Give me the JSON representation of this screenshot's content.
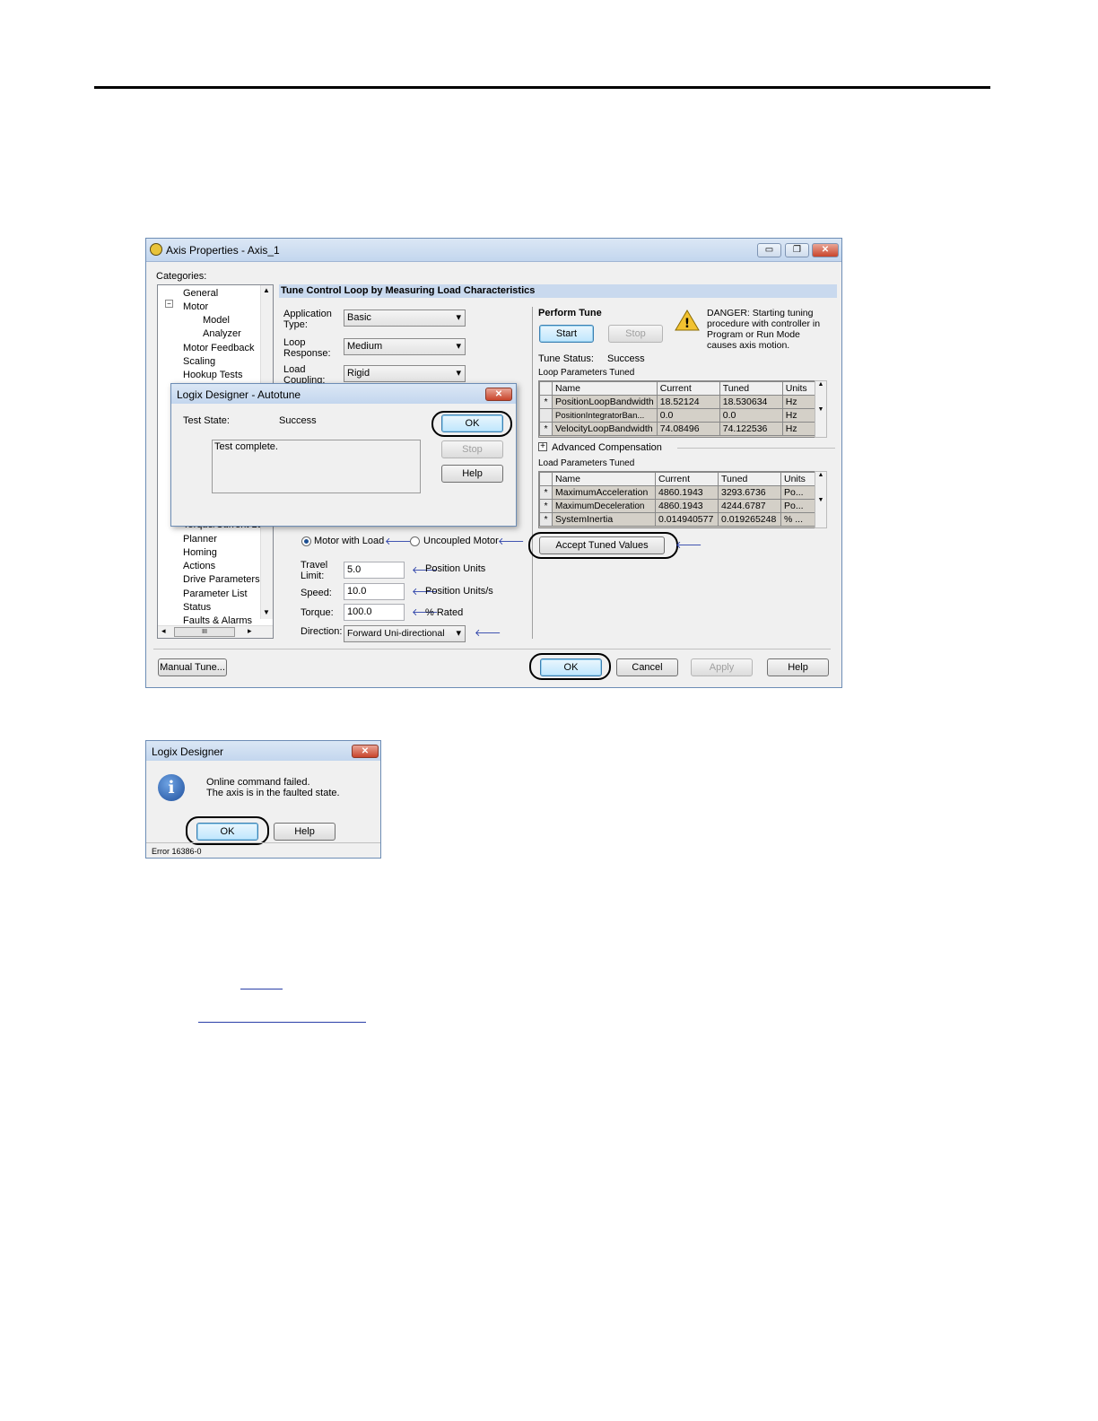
{
  "window": {
    "title": "Axis Properties - Axis_1",
    "categories_label": "Categories:",
    "tree": [
      "General",
      "Motor",
      "Model",
      "Analyzer",
      "Motor Feedback",
      "Scaling",
      "Hookup Tests",
      "Torque/Current Lo",
      "Planner",
      "Homing",
      "Actions",
      "Drive Parameters",
      "Parameter List",
      "Status",
      "Faults & Alarms"
    ],
    "hscroll_thumb": "III",
    "section_title": "Tune Control Loop by Measuring Load Characteristics",
    "application_type_label": "Application Type:",
    "application_type_value": "Basic",
    "loop_response_label": "Loop Response:",
    "loop_response_value": "Medium",
    "load_coupling_label": "Load Coupling:",
    "load_coupling_value": "Rigid",
    "motor_with_load": "Motor with Load",
    "uncoupled_motor": "Uncoupled Motor",
    "travel_limit_label": "Travel Limit:",
    "travel_limit_value": "5.0",
    "travel_limit_unit": "Position Units",
    "speed_label": "Speed:",
    "speed_value": "10.0",
    "speed_unit": "Position Units/s",
    "torque_label": "Torque:",
    "torque_value": "100.0",
    "torque_unit": "% Rated",
    "direction_label": "Direction:",
    "direction_value": "Forward Uni-directional",
    "perform_tune": "Perform Tune",
    "start": "Start",
    "stop": "Stop",
    "danger": "DANGER: Starting tuning procedure with controller in Program or Run Mode causes axis motion.",
    "tune_status_label": "Tune Status:",
    "tune_status_value": "Success",
    "loop_params_label": "Loop Parameters Tuned",
    "load_params_label": "Load Parameters Tuned",
    "advanced_comp": "Advanced Compensation",
    "grid_headers": [
      "Name",
      "Current",
      "Tuned",
      "Units"
    ],
    "loop_rows": [
      {
        "star": "*",
        "name": "PositionLoopBandwidth",
        "current": "18.52124",
        "tuned": "18.530634",
        "units": "Hz"
      },
      {
        "star": "",
        "name": "PositionIntegratorBan...",
        "current": "0.0",
        "tuned": "0.0",
        "units": "Hz"
      },
      {
        "star": "*",
        "name": "VelocityLoopBandwidth",
        "current": "74.08496",
        "tuned": "74.122536",
        "units": "Hz"
      }
    ],
    "load_rows": [
      {
        "star": "*",
        "name": "MaximumAcceleration",
        "current": "4860.1943",
        "tuned": "3293.6736",
        "units": "Po..."
      },
      {
        "star": "*",
        "name": "MaximumDeceleration",
        "current": "4860.1943",
        "tuned": "4244.6787",
        "units": "Po..."
      },
      {
        "star": "*",
        "name": "SystemInertia",
        "current": "0.014940577",
        "tuned": "0.019265248",
        "units": "% ..."
      }
    ],
    "accept_tuned": "Accept Tuned Values",
    "manual_tune": "Manual Tune...",
    "ok": "OK",
    "cancel": "Cancel",
    "apply": "Apply",
    "help": "Help"
  },
  "autotune": {
    "title": "Logix Designer - Autotune",
    "test_state_label": "Test State:",
    "test_state_value": "Success",
    "message": "Test complete.",
    "ok": "OK",
    "stop": "Stop",
    "help": "Help"
  },
  "error_dialog": {
    "title": "Logix Designer",
    "line1": "Online command failed.",
    "line2": "The axis is in the faulted state.",
    "ok": "OK",
    "help": "Help",
    "code": "Error 16386-0"
  },
  "colors": {
    "title_bar": "#c3d6ee",
    "section_bar": "#c9d9ee",
    "link": "#2a3fa8"
  }
}
